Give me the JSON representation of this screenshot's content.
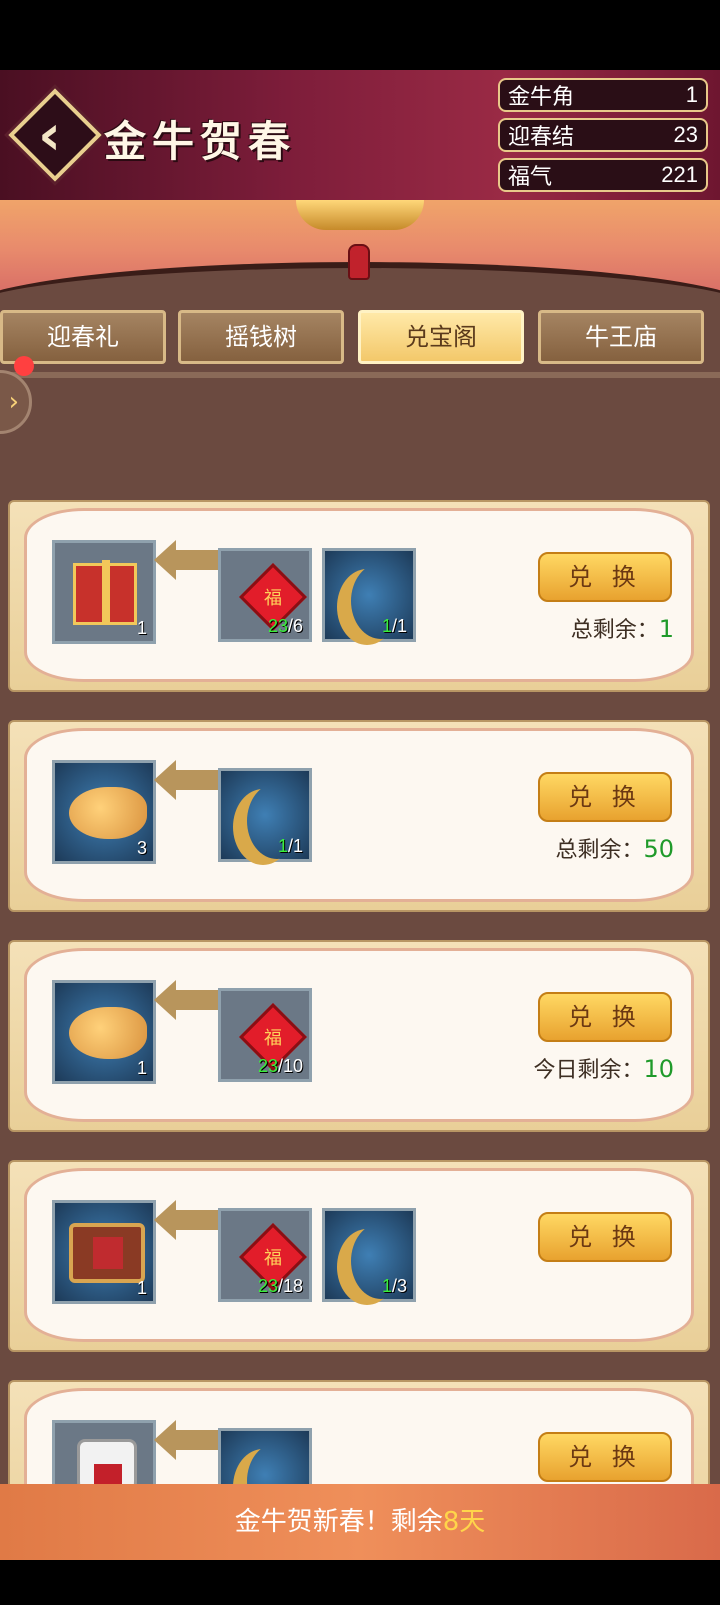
{
  "header": {
    "title": "金牛贺春",
    "currencies": [
      {
        "name": "金牛角",
        "value": "1"
      },
      {
        "name": "迎春结",
        "value": "23"
      },
      {
        "name": "福气",
        "value": "221"
      }
    ]
  },
  "tabs": [
    {
      "label": "迎春礼"
    },
    {
      "label": "摇钱树"
    },
    {
      "label": "兑宝阁"
    },
    {
      "label": "牛王庙"
    }
  ],
  "active_tab": "兑宝阁",
  "exchange_items": [
    {
      "reward": {
        "icon": "gift-box-icon",
        "qty": "1"
      },
      "costs": [
        {
          "icon": "chinese-knot-icon",
          "have": "23",
          "need": "/6"
        },
        {
          "icon": "golden-horn-icon",
          "have": "1",
          "need": "/1"
        }
      ],
      "button": "兑 换",
      "remaining_label": "总剩余：",
      "remaining_value": "1"
    },
    {
      "reward": {
        "icon": "golden-ox-icon",
        "qty": "3"
      },
      "costs": [
        {
          "icon": "golden-horn-icon",
          "have": "1",
          "need": "/1"
        }
      ],
      "button": "兑 换",
      "remaining_label": "总剩余：",
      "remaining_value": "50"
    },
    {
      "reward": {
        "icon": "golden-ox-icon",
        "qty": "1"
      },
      "costs": [
        {
          "icon": "chinese-knot-icon",
          "have": "23",
          "need": "/10"
        }
      ],
      "button": "兑 换",
      "remaining_label": "今日剩余：",
      "remaining_value": "10"
    },
    {
      "reward": {
        "icon": "treasure-chest-icon",
        "qty": "1"
      },
      "costs": [
        {
          "icon": "chinese-knot-icon",
          "have": "23",
          "need": "/18"
        },
        {
          "icon": "golden-horn-icon",
          "have": "1",
          "need": "/3"
        }
      ],
      "button": "兑 换"
    },
    {
      "reward": {
        "icon": "emblem-icon",
        "qty": ""
      },
      "costs": [
        {
          "icon": "golden-horn-icon",
          "have": "",
          "need": ""
        }
      ],
      "button": "兑 换"
    }
  ],
  "footer": {
    "text": "金牛贺新春！剩余",
    "days": "8天"
  }
}
